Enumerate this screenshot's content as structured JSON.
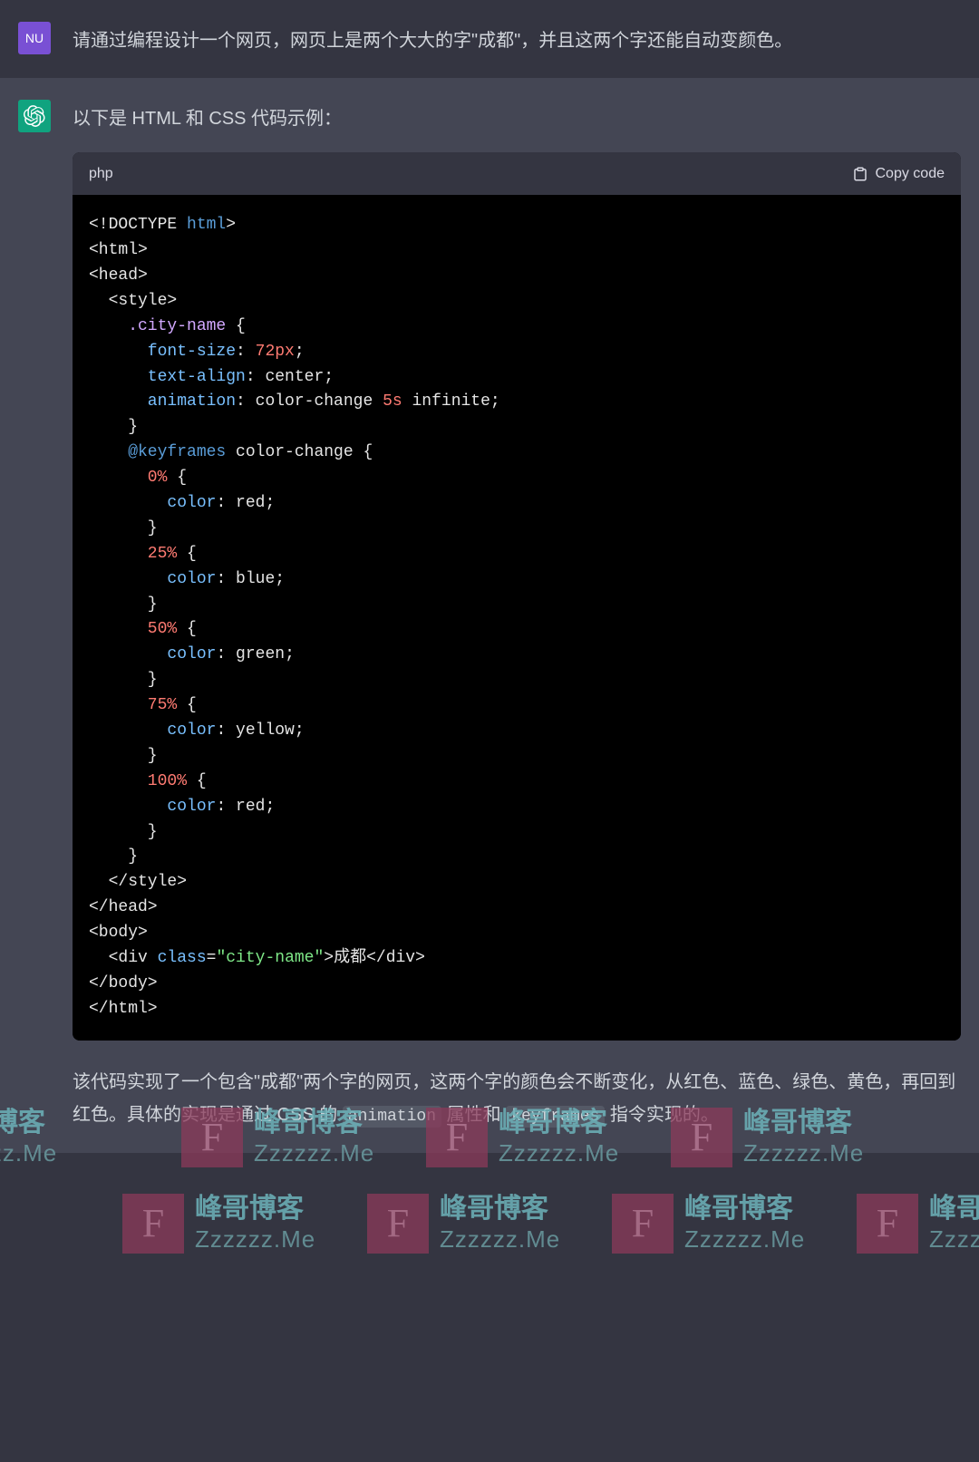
{
  "user": {
    "avatar_text": "NU",
    "prompt": "请通过编程设计一个网页，网页上是两个大大的字\"成都\"，并且这两个字还能自动变颜色。"
  },
  "assistant": {
    "intro": "以下是 HTML 和 CSS 代码示例：",
    "code_lang": "php",
    "copy_label": "Copy code",
    "explanation_prefix": "该代码实现了一个包含\"成都\"两个字的网页，这两个字的颜色会不断变化，从红色、蓝色、绿色、黄色，再回到红色。具体的实现是通过 CSS 的 ",
    "inline_code_1": "animation",
    "explanation_mid": " 属性和 ",
    "inline_code_2": "keyframes",
    "explanation_suffix": " 指令实现的。"
  },
  "code": {
    "doctype_open": "<!DOCTYPE ",
    "doctype_kw": "html",
    "doctype_close": ">",
    "html_open": "<html>",
    "head_open": "<head>",
    "style_open": "  <style>",
    "selector": "    .city-name",
    "brace_open": " {",
    "prop_fontsize": "      font-size",
    "val_72px": "72px",
    "prop_textalign": "      text-align",
    "val_center": "center",
    "prop_animation": "      animation",
    "val_colorchange": "color-change ",
    "val_5s": "5s",
    "val_infinite": " infinite",
    "close_brace1": "    }",
    "at_keyframes": "    @keyframes",
    "kf_name": " color-change {",
    "pct_0": "      0%",
    "pct_25": "      25%",
    "pct_50": "      50%",
    "pct_75": "      75%",
    "pct_100": "      100%",
    "prop_color": "        color",
    "val_red": "red",
    "val_blue": "blue",
    "val_green": "green",
    "val_yellow": "yellow",
    "inner_close": "      }",
    "kf_close": "    }",
    "style_close": "  </style>",
    "head_close": "</head>",
    "body_open": "<body>",
    "div_open": "  <div ",
    "class_attr": "class",
    "class_val": "\"city-name\"",
    "div_text": "成都",
    "div_close": "</div>",
    "body_close": "</body>",
    "html_close": "</html>",
    "colon": ": ",
    "semi": ";",
    "eq": "=",
    "gt": ">",
    "brace_open_only": " {"
  },
  "watermark": {
    "badge": "F",
    "title": "峰哥博客",
    "sub": "Zzzzzz.Me"
  }
}
